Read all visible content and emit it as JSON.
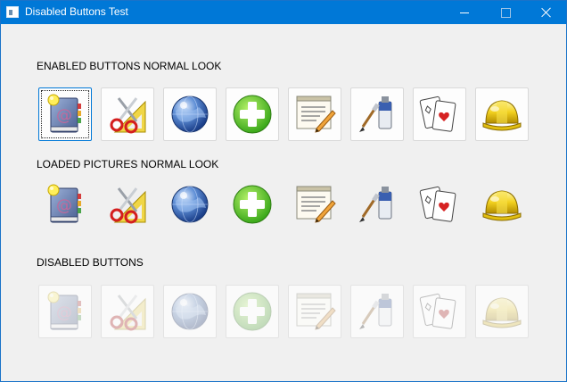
{
  "window": {
    "title": "Disabled Buttons Test",
    "controls": [
      "minimize",
      "maximize",
      "close"
    ]
  },
  "sections": {
    "enabled": {
      "label": "ENABLED BUTTONS NORMAL LOOK"
    },
    "pictures": {
      "label": "LOADED PICTURES NORMAL LOOK"
    },
    "disabled": {
      "label": "DISABLED BUTTONS"
    }
  },
  "icons": [
    "address-book-icon",
    "scissors-ruler-icon",
    "globe-icon",
    "plus-circle-icon",
    "notepad-pencil-icon",
    "paint-tube-brush-icon",
    "playing-cards-icon",
    "hard-hat-icon"
  ],
  "colors": {
    "titlebar": "#0078d7",
    "window_bg": "#f0f0f0",
    "focus_border": "#0078d7"
  }
}
